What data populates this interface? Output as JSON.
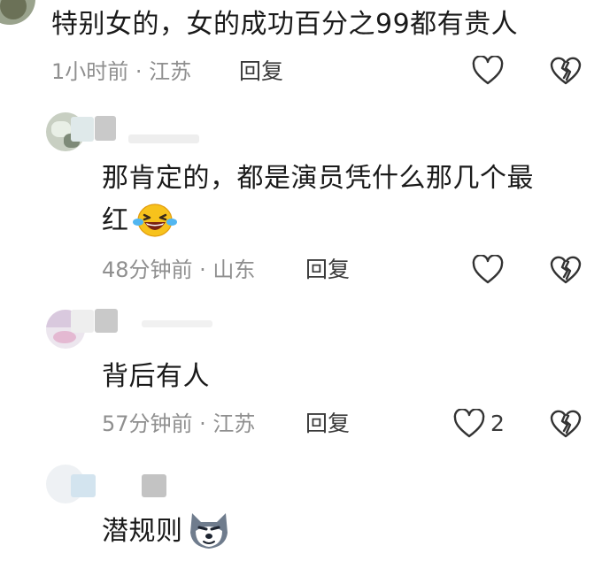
{
  "comments": [
    {
      "text": "特别女的，女的成功百分之99都有贵人",
      "meta": "1小时前 · 江苏",
      "reply": "回复",
      "likes": ""
    },
    {
      "text_line1": "那肯定的，都是演员凭什么那几个最",
      "text_line2": "红",
      "emoji": "laughing-tears-emoji",
      "meta": "48分钟前 · 山东",
      "reply": "回复",
      "likes": ""
    },
    {
      "text": "背后有人",
      "meta": "57分钟前 · 江苏",
      "reply": "回复",
      "likes": "2"
    },
    {
      "text": "潜规则",
      "emoji": "doge-dog-emoji",
      "meta": "",
      "reply": "",
      "likes": ""
    }
  ],
  "colors": {
    "meta_gray": "#8f8f8f",
    "icon_stroke": "#333333"
  },
  "icons": {
    "like": "heart-outline-icon",
    "dislike": "broken-heart-icon"
  }
}
